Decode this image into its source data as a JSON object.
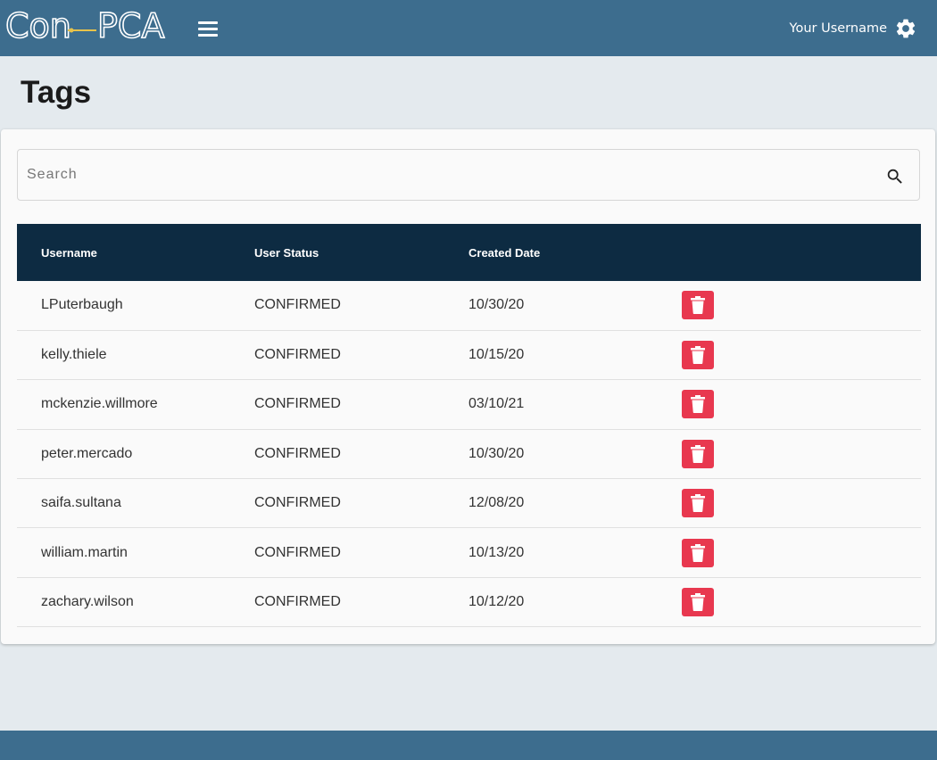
{
  "header": {
    "logo_text": "Con-PCA",
    "username": "Your Username"
  },
  "page": {
    "title": "Tags"
  },
  "search": {
    "placeholder": "Search",
    "value": ""
  },
  "table": {
    "columns": [
      "Username",
      "User Status",
      "Created Date",
      ""
    ],
    "rows": [
      {
        "username": "LPuterbaugh",
        "status": "CONFIRMED",
        "created": "10/30/20"
      },
      {
        "username": "kelly.thiele",
        "status": "CONFIRMED",
        "created": "10/15/20"
      },
      {
        "username": "mckenzie.willmore",
        "status": "CONFIRMED",
        "created": "03/10/21"
      },
      {
        "username": "peter.mercado",
        "status": "CONFIRMED",
        "created": "10/30/20"
      },
      {
        "username": "saifa.sultana",
        "status": "CONFIRMED",
        "created": "12/08/20"
      },
      {
        "username": "william.martin",
        "status": "CONFIRMED",
        "created": "10/13/20"
      },
      {
        "username": "zachary.wilson",
        "status": "CONFIRMED",
        "created": "10/12/20"
      }
    ],
    "row_action_icon": "trash-icon"
  },
  "colors": {
    "topbar": "#3d6d8e",
    "table_header": "#0d2b42",
    "delete_button": "#e8384f",
    "background": "#e4eaee"
  },
  "icons": {
    "menu": "hamburger-menu-icon",
    "settings": "gear-icon",
    "search": "search-icon",
    "delete": "trash-icon"
  }
}
